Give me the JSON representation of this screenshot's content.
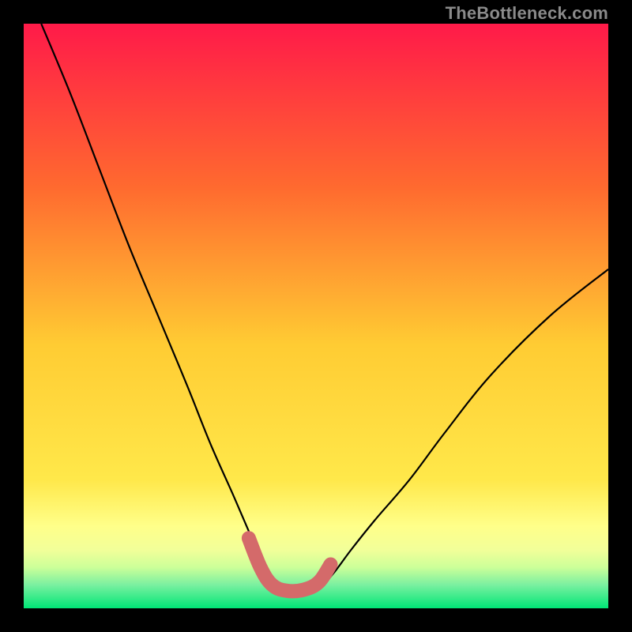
{
  "watermark": "TheBottleneck.com",
  "colors": {
    "black": "#000000",
    "grad_top": "#ff1a49",
    "grad_mid_upper": "#ff7a2a",
    "grad_mid": "#ffe233",
    "grad_band_light": "#ffff99",
    "grad_band_pale": "#e6ff99",
    "grad_green": "#00e676",
    "curve": "#000000",
    "salmon": "#d46a6a"
  },
  "chart_data": {
    "type": "line",
    "title": "",
    "xlabel": "",
    "ylabel": "",
    "xlim": [
      0,
      100
    ],
    "ylim": [
      0,
      100
    ],
    "series": [
      {
        "name": "bottleneck-curve",
        "x": [
          3,
          8,
          13,
          18,
          23,
          28,
          32,
          36,
          39,
          41,
          43,
          45,
          48,
          51,
          53,
          56,
          60,
          66,
          72,
          80,
          90,
          100
        ],
        "y": [
          100,
          88,
          75,
          62,
          50,
          38,
          28,
          19,
          12,
          7,
          4,
          3,
          3,
          4,
          6,
          10,
          15,
          22,
          30,
          40,
          50,
          58
        ]
      },
      {
        "name": "highlight-segment",
        "x": [
          38.5,
          40.5,
          42.5,
          45,
          48,
          50.5,
          52.5
        ],
        "y": [
          12,
          7,
          4,
          3,
          3.2,
          4.5,
          7.5
        ]
      }
    ],
    "annotations": []
  }
}
